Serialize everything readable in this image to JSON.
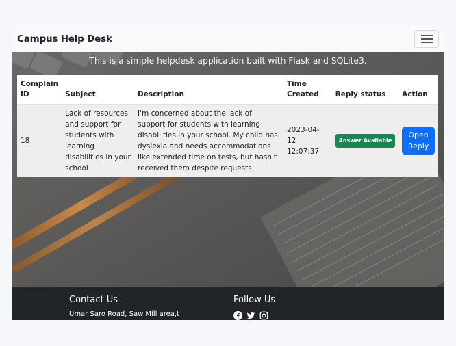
{
  "navbar": {
    "brand": "Campus Help Desk",
    "menu_icon": "hamburger-icon"
  },
  "hero": {
    "subtitle": "This is a simple helpdesk application built with Flask and SQLite3."
  },
  "table": {
    "headers": {
      "id": "Complain ID",
      "subject": "Subject",
      "description": "Description",
      "time": "Time Created",
      "status": "Reply status",
      "action": "Action"
    },
    "rows": [
      {
        "id": "18",
        "subject": "Lack of resources and support for students with learning disabilities in your school",
        "description": "I'm concerned about the lack of support for students with learning disabilities in your school. My child has dyslexia and needs accommodations like extended time on tests, but hasn't received them despite requests.",
        "time": "2023-04-12 12:07:37",
        "status": "Answer Available",
        "action": "Open Reply"
      }
    ]
  },
  "footer": {
    "contact_heading": "Contact Us",
    "contact_address": "Umar Saro Road, Saw Mill area,t",
    "follow_heading": "Follow Us",
    "social_icons": [
      "facebook-icon",
      "twitter-icon",
      "instagram-icon"
    ]
  },
  "colors": {
    "badge_success": "#198754",
    "button_primary": "#0d6efd",
    "footer_bg": "#212529",
    "navbar_bg": "#f8f9fa"
  }
}
